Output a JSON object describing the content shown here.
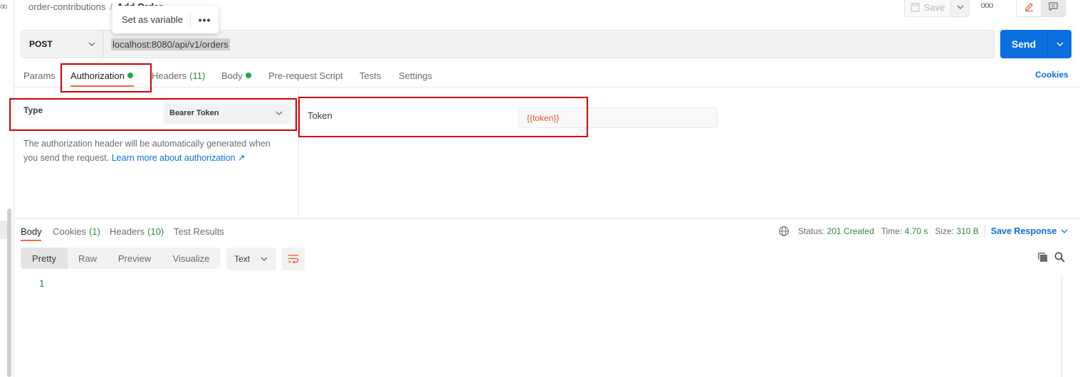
{
  "breadcrumb": {
    "parent": "order-contributions",
    "separator": "/",
    "current": "Add Order"
  },
  "variable_popup": {
    "label": "Set as variable",
    "more": "•••"
  },
  "toolbar": {
    "save_label": "Save",
    "more": "ooo"
  },
  "request": {
    "method": "POST",
    "url": "localhost:8080/api/v1/orders",
    "send_label": "Send"
  },
  "request_tabs": {
    "params": "Params",
    "authorization": "Authorization",
    "headers": "Headers",
    "headers_count": "(11)",
    "body": "Body",
    "prerequest": "Pre-request Script",
    "tests": "Tests",
    "settings": "Settings",
    "cookies": "Cookies"
  },
  "auth": {
    "type_label": "Type",
    "type_value": "Bearer Token",
    "description": "The authorization header will be automatically generated when you send the request.",
    "learn_more": "Learn more about authorization ↗",
    "token_label": "Token",
    "token_value": "{{token}}"
  },
  "response_tabs": {
    "body": "Body",
    "cookies": "Cookies",
    "cookies_count": "(1)",
    "headers": "Headers",
    "headers_count": "(10)",
    "test_results": "Test Results"
  },
  "response_meta": {
    "status_label": "Status:",
    "status_value": "201 Created",
    "time_label": "Time:",
    "time_value": "4.70 s",
    "size_label": "Size:",
    "size_value": "310 B",
    "save_response": "Save Response"
  },
  "response_view": {
    "modes": [
      "Pretty",
      "Raw",
      "Preview",
      "Visualize"
    ],
    "format": "Text",
    "line_number": "1"
  },
  "colors": {
    "accent_orange": "#f26b3a",
    "primary_blue": "#0b6fe0",
    "success_green": "#1da84a",
    "highlight_red": "#d10000"
  }
}
